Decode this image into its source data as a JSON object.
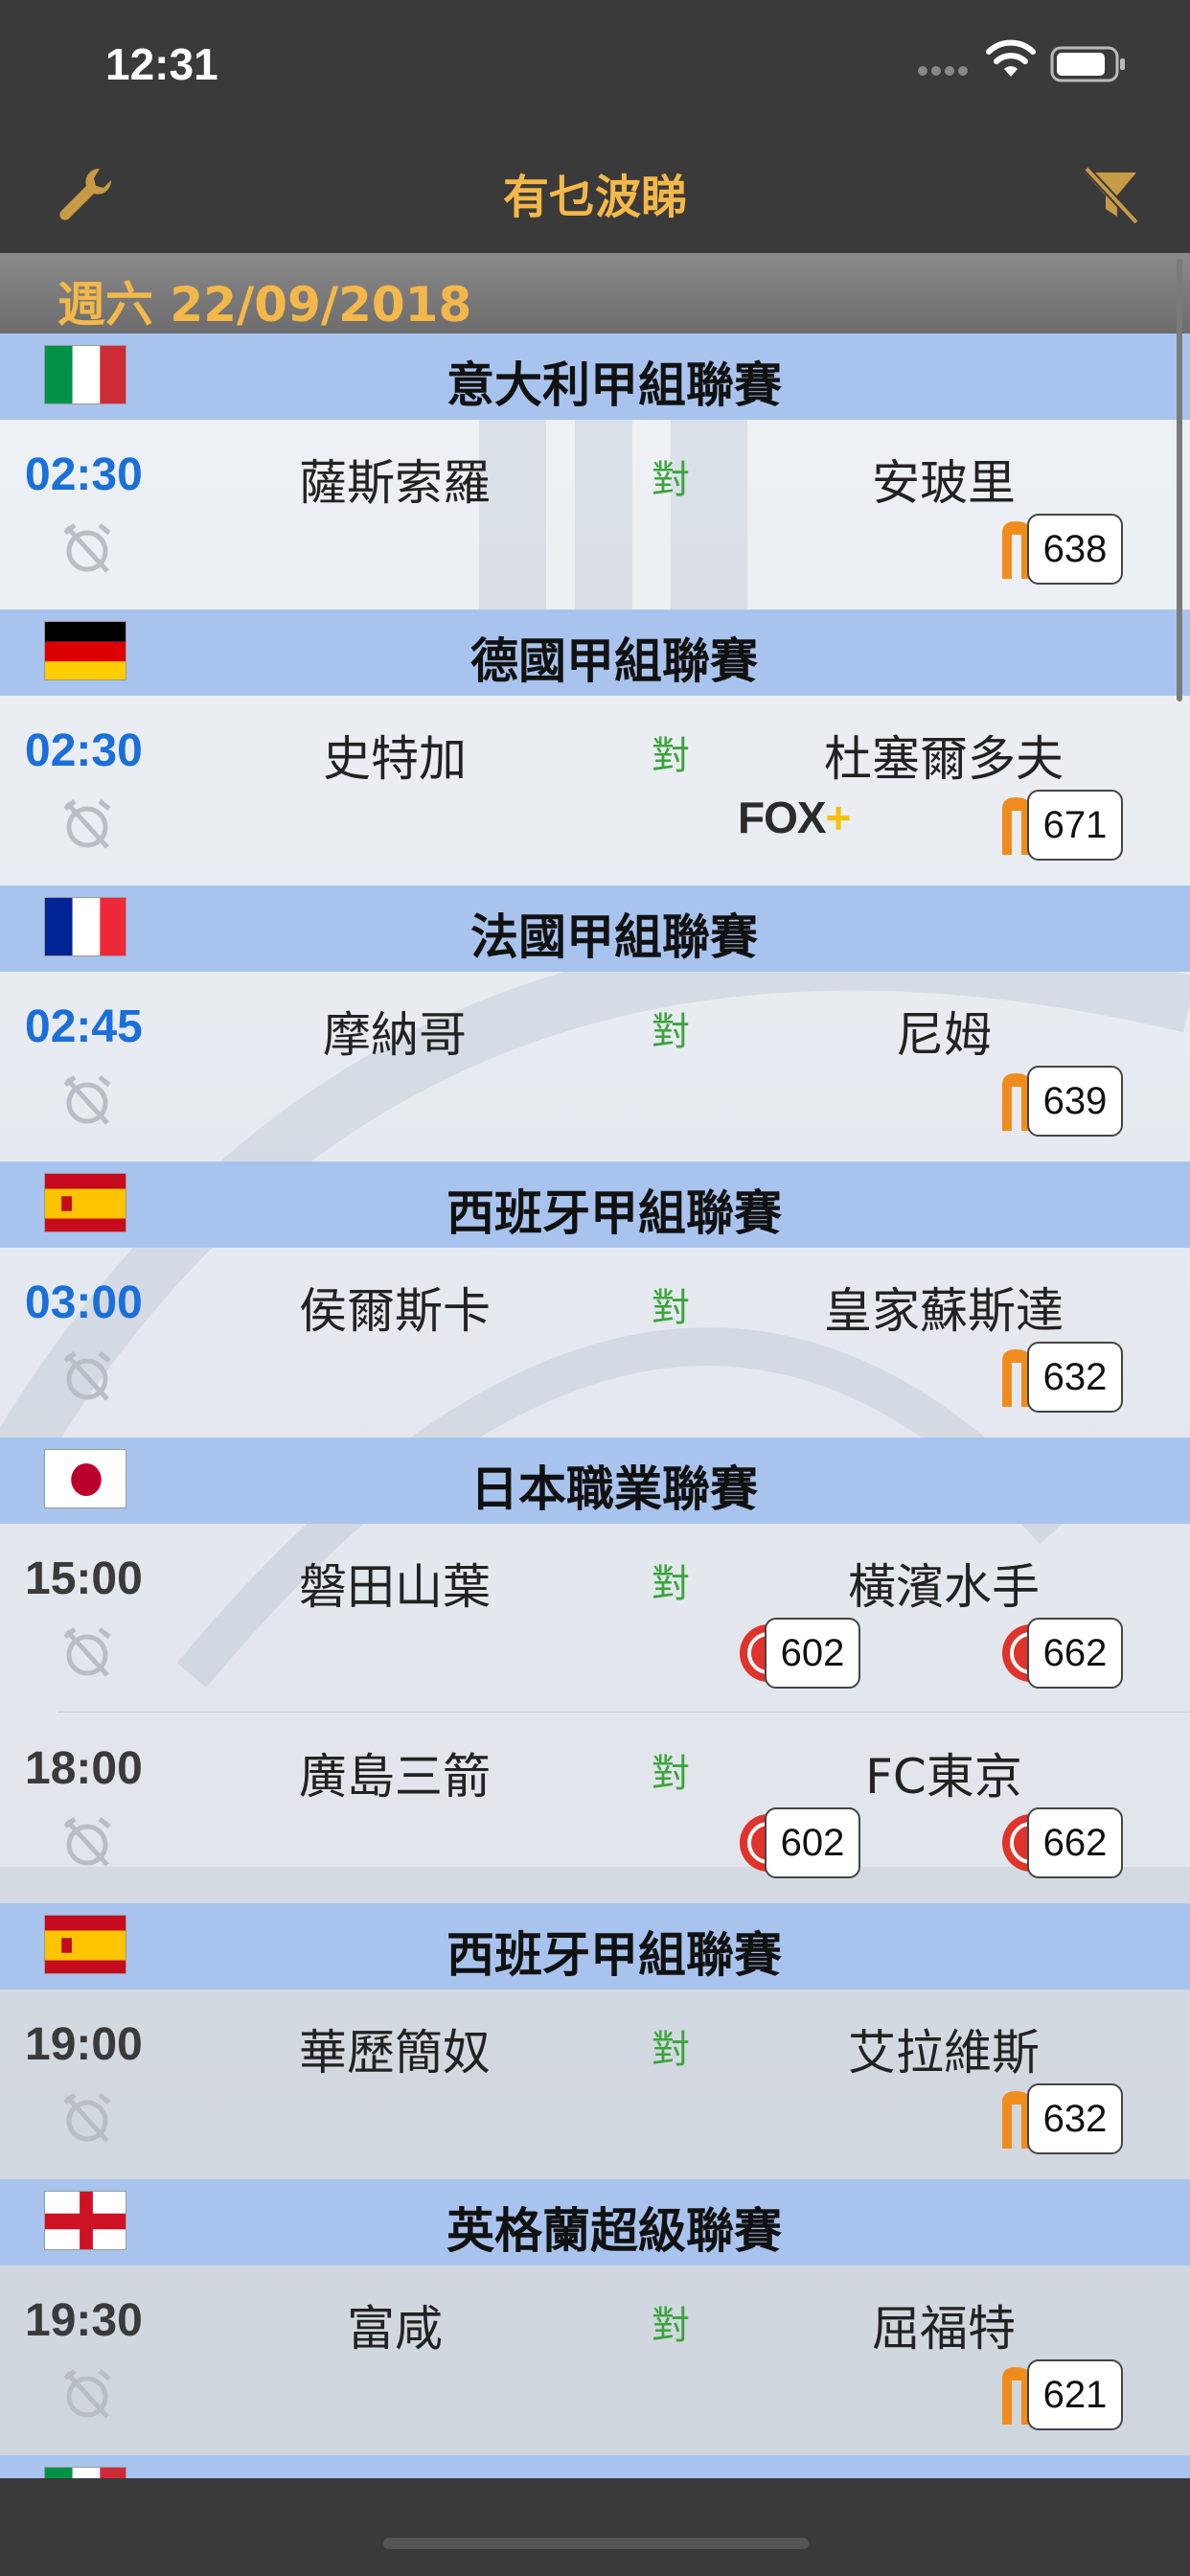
{
  "status_bar": {
    "time": "12:31"
  },
  "nav": {
    "title": "有乜波睇",
    "left_icon": "wrench-icon",
    "right_icon": "filter-icon"
  },
  "date_header": "週六 22/09/2018",
  "colors": {
    "accent": "#f4b84a",
    "live_time": "#1a6fd8",
    "versus": "#3aa53a",
    "league_bar": "#a8c4ee",
    "now_tv": "#f08c1e",
    "i_cable": "#e0332b"
  },
  "leagues": [
    {
      "name": "意大利甲組聯賽",
      "flag": "italy-flag",
      "matches": [
        {
          "time": "02:30",
          "home": "薩斯索羅",
          "vs": "對",
          "away": "安玻里",
          "channels": [
            {
              "provider": "now-tv",
              "number": "638"
            }
          ]
        }
      ]
    },
    {
      "name": "德國甲組聯賽",
      "flag": "germany-flag",
      "matches": [
        {
          "time": "02:30",
          "home": "史特加",
          "vs": "對",
          "away": "杜塞爾多夫",
          "fox": {
            "text": "FOX",
            "plus": "+"
          },
          "channels": [
            {
              "provider": "now-tv",
              "number": "671"
            }
          ]
        }
      ]
    },
    {
      "name": "法國甲組聯賽",
      "flag": "france-flag",
      "matches": [
        {
          "time": "02:45",
          "home": "摩納哥",
          "vs": "對",
          "away": "尼姆",
          "channels": [
            {
              "provider": "now-tv",
              "number": "639"
            }
          ]
        }
      ]
    },
    {
      "name": "西班牙甲組聯賽",
      "flag": "spain-flag",
      "matches": [
        {
          "time": "03:00",
          "home": "侯爾斯卡",
          "vs": "對",
          "away": "皇家蘇斯達",
          "channels": [
            {
              "provider": "now-tv",
              "number": "632"
            }
          ]
        }
      ]
    },
    {
      "name": "日本職業聯賽",
      "flag": "japan-flag",
      "matches": [
        {
          "time": "15:00",
          "home": "磐田山葉",
          "vs": "對",
          "away": "橫濱水手",
          "channels": [
            {
              "provider": "i-cable",
              "number": "602"
            },
            {
              "provider": "i-cable",
              "number": "662"
            }
          ]
        },
        {
          "time": "18:00",
          "home": "廣島三箭",
          "vs": "對",
          "away": "FC東京",
          "channels": [
            {
              "provider": "i-cable",
              "number": "602"
            },
            {
              "provider": "i-cable",
              "number": "662"
            }
          ]
        }
      ]
    },
    {
      "name": "西班牙甲組聯賽",
      "flag": "spain-flag",
      "matches": [
        {
          "time": "19:00",
          "home": "華歷簡奴",
          "vs": "對",
          "away": "艾拉維斯",
          "channels": [
            {
              "provider": "now-tv",
              "number": "632"
            }
          ]
        }
      ]
    },
    {
      "name": "英格蘭超級聯賽",
      "flag": "england-flag",
      "matches": [
        {
          "time": "19:30",
          "home": "富咸",
          "vs": "對",
          "away": "屈福特",
          "channels": [
            {
              "provider": "now-tv",
              "number": "621"
            }
          ]
        }
      ]
    }
  ]
}
